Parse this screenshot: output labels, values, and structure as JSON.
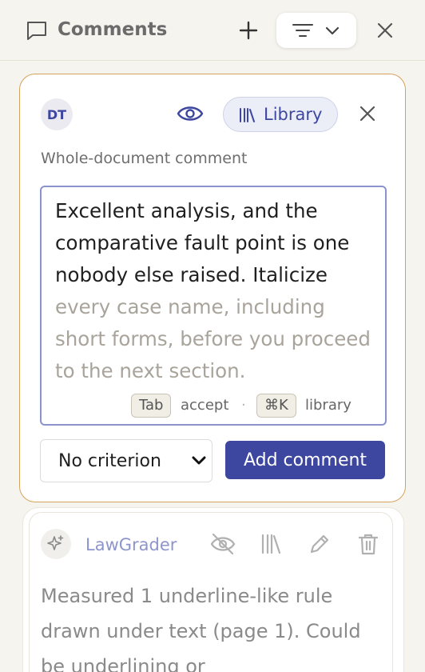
{
  "header": {
    "title": "Comments",
    "icons": {
      "comment": "comment-bubble-icon",
      "add": "plus-icon",
      "sort": "sort-lines-icon",
      "dropdown": "chevron-down-icon",
      "close": "close-icon"
    }
  },
  "draft": {
    "author_initials": "DT",
    "library_label": "Library",
    "scope_label": "Whole-document comment",
    "typed_text": "Excellent analysis, and the comparative fault point is one nobody else raised. Italicize",
    "suggested_text": " every case name, including short forms, before you proceed to the next section.",
    "hint": {
      "tab_key": "Tab",
      "tab_action": "accept",
      "separator": "·",
      "lib_key": "⌘K",
      "lib_action": "library"
    },
    "criterion_selected": "No criterion",
    "submit_label": "Add comment",
    "colors": {
      "accent": "#3d47a0",
      "border": "#d7a25c"
    }
  },
  "comment": {
    "author": "LawGrader",
    "body": "Measured 1 underline-like rule drawn under text (page 1). Could be underlining or",
    "icons": [
      "eye-off-icon",
      "library-icon",
      "pencil-icon",
      "trash-icon"
    ]
  }
}
